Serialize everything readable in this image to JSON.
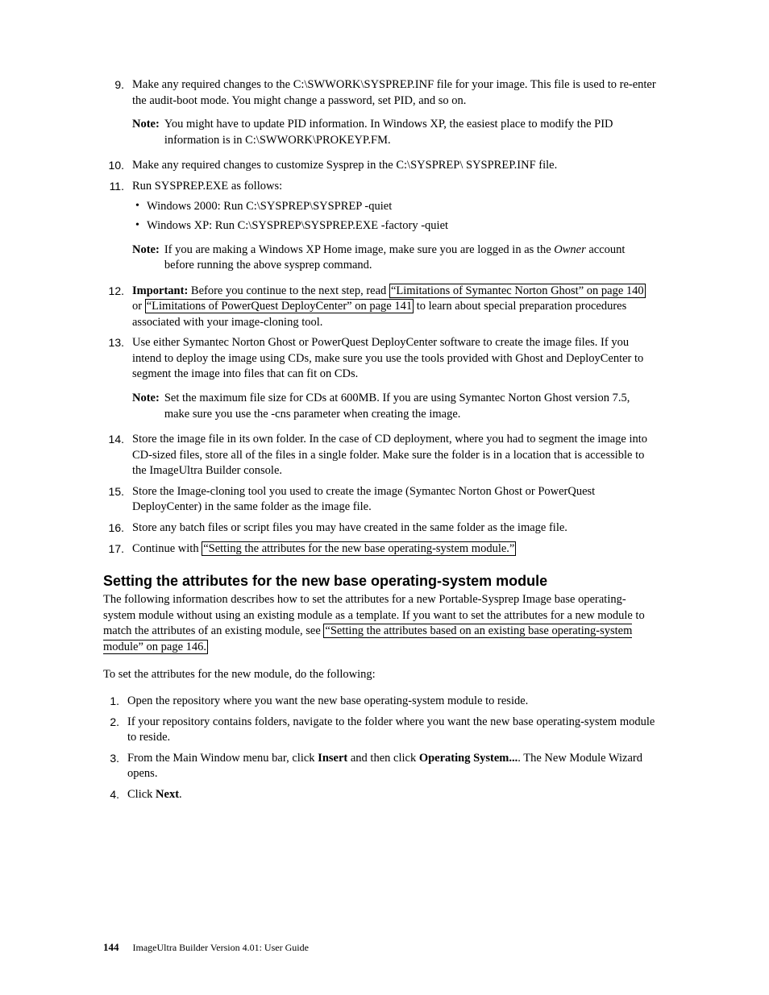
{
  "list1": {
    "item9": {
      "num": "9.",
      "text": "Make any required changes to the C:\\SWWORK\\SYSPREP.INF file for your image. This file is used to re-enter the audit-boot mode. You might change a password, set PID, and so on.",
      "note_label": "Note:",
      "note_text": "You might have to update PID information. In Windows XP, the easiest place to modify the PID information is in C:\\SWWORK\\PROKEYP.FM."
    },
    "item10": {
      "num": "10.",
      "text": "Make any required changes to customize Sysprep in the C:\\SYSPREP\\ SYSPREP.INF file."
    },
    "item11": {
      "num": "11.",
      "text": "Run SYSPREP.EXE as follows:",
      "b1": "Windows 2000: Run C:\\SYSPREP\\SYSPREP -quiet",
      "b2": "Windows XP: Run C:\\SYSPREP\\SYSPREP.EXE -factory -quiet",
      "note_label": "Note:",
      "note_pre": "If you are making a Windows XP Home image, make sure you are logged in as the ",
      "note_em": "Owner",
      "note_post": " account before running the above sysprep command."
    },
    "item12": {
      "num": "12.",
      "imp": "Important:",
      "t1": " Before you continue to the next step, read ",
      "link1": "“Limitations of Symantec Norton Ghost” on page 140",
      "t2": " or ",
      "link2": "“Limitations of PowerQuest DeployCenter” on page 141",
      "t3": " to learn about special preparation procedures associated with your image-cloning tool."
    },
    "item13": {
      "num": "13.",
      "text": "Use either Symantec Norton Ghost or PowerQuest DeployCenter software to create the image files. If you intend to deploy the image using CDs, make sure you use the tools provided with Ghost and DeployCenter to segment the image into files that can fit on CDs.",
      "note_label": "Note:",
      "note_text": "Set the maximum file size for CDs at 600MB. If you are using Symantec Norton Ghost version 7.5, make sure you use the -cns parameter when creating the image."
    },
    "item14": {
      "num": "14.",
      "text": "Store the image file in its own folder. In the case of CD deployment, where you had to segment the image into CD-sized files, store all of the files in a single folder. Make sure the folder is in a location that is accessible to the ImageUltra Builder console."
    },
    "item15": {
      "num": "15.",
      "text": "Store the Image-cloning tool you used to create the image (Symantec Norton Ghost or PowerQuest DeployCenter) in the same folder as the image file."
    },
    "item16": {
      "num": "16.",
      "text": "Store any batch files or script files you may have created in the same folder as the image file."
    },
    "item17": {
      "num": "17.",
      "t1": "Continue with ",
      "link": "“Setting the attributes for the new base operating-system module.”"
    }
  },
  "section": {
    "heading": "Setting the attributes for the new base operating-system module",
    "p1_a": "The following information describes how to set the attributes for a new Portable-Sysprep Image base operating-system module without using an existing module as a template. If you want to set the attributes for a new module to match the attributes of an existing module, see ",
    "p1_link": "“Setting the attributes based on an existing base operating-system module” on page 146.",
    "p2": "To set the attributes for the new module, do the following:"
  },
  "list2": {
    "i1": {
      "num": "1.",
      "text": "Open the repository where you want the new base operating-system module to reside."
    },
    "i2": {
      "num": "2.",
      "text": "If your repository contains folders, navigate to the folder where you want the new base operating-system module to reside."
    },
    "i3": {
      "num": "3.",
      "t1": "From the Main Window menu bar, click ",
      "b1": "Insert",
      "t2": " and then click ",
      "b2": "Operating System...",
      "t3": ". The New Module Wizard opens."
    },
    "i4": {
      "num": "4.",
      "t1": "Click ",
      "b1": "Next",
      "t2": "."
    }
  },
  "footer": {
    "page": "144",
    "title": "ImageUltra Builder Version 4.01: User Guide"
  }
}
